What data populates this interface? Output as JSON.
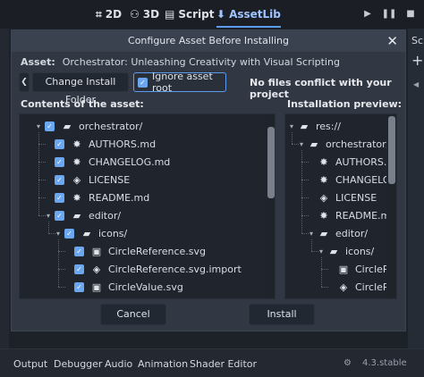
{
  "workspaces": [
    {
      "label": "2D",
      "icon": "2d-icon"
    },
    {
      "label": "3D",
      "icon": "3d-icon"
    },
    {
      "label": "Script",
      "icon": "script-icon"
    },
    {
      "label": "AssetLib",
      "icon": "assetlib-icon"
    }
  ],
  "right_panel": {
    "label": "Sc"
  },
  "dialog": {
    "title": "Configure Asset Before Installing",
    "asset_label": "Asset:",
    "asset_name": "Orchestrator: Unleashing Creativity with Visual Scripting",
    "change_folder_label": "Change Install Folder",
    "ignore_root_label": "Ignore asset root",
    "ignore_root_checked": true,
    "conflict_status": "No files conflict with your project",
    "contents_heading": "Contents of the asset:",
    "preview_heading": "Installation preview:",
    "cancel_label": "Cancel",
    "install_label": "Install"
  },
  "contents_tree": [
    {
      "name": "orchestrator/",
      "type": "folder",
      "level": 0,
      "expanded": true,
      "checked": true
    },
    {
      "name": "AUTHORS.md",
      "type": "markdown",
      "level": 1,
      "checked": true
    },
    {
      "name": "CHANGELOG.md",
      "type": "markdown",
      "level": 1,
      "checked": true
    },
    {
      "name": "LICENSE",
      "type": "file",
      "level": 1,
      "checked": true
    },
    {
      "name": "README.md",
      "type": "markdown",
      "level": 1,
      "checked": true
    },
    {
      "name": "editor/",
      "type": "folder",
      "level": 1,
      "expanded": true,
      "checked": true
    },
    {
      "name": "icons/",
      "type": "folder",
      "level": 2,
      "expanded": true,
      "checked": true
    },
    {
      "name": "CircleReference.svg",
      "type": "image",
      "level": 3,
      "checked": true
    },
    {
      "name": "CircleReference.svg.import",
      "type": "file",
      "level": 3,
      "checked": true
    },
    {
      "name": "CircleValue.svg",
      "type": "image",
      "level": 3,
      "checked": true
    }
  ],
  "preview_tree": [
    {
      "name": "res://",
      "type": "folder",
      "level": 0,
      "expanded": true
    },
    {
      "name": "orchestrator/",
      "type": "folder",
      "level": 1,
      "expanded": true
    },
    {
      "name": "AUTHORS.md",
      "type": "markdown",
      "level": 2
    },
    {
      "name": "CHANGELOG.md",
      "type": "markdown",
      "level": 2
    },
    {
      "name": "LICENSE",
      "type": "file",
      "level": 2
    },
    {
      "name": "README.md",
      "type": "markdown",
      "level": 2
    },
    {
      "name": "editor/",
      "type": "folder",
      "level": 2,
      "expanded": true
    },
    {
      "name": "icons/",
      "type": "folder",
      "level": 3,
      "expanded": true
    },
    {
      "name": "CircleReference.svg",
      "type": "image",
      "level": 4
    },
    {
      "name": "CircleReference.svg.import",
      "type": "file",
      "level": 4
    }
  ],
  "bottom_tabs": [
    "Output",
    "Debugger",
    "Audio",
    "Animation",
    "Shader Editor"
  ],
  "version": "4.3.stable",
  "colors": {
    "accent": "#5d9cec",
    "checkbox": "#6aa7f0",
    "dialog_bg": "#313844",
    "tree_bg": "#20252d"
  }
}
